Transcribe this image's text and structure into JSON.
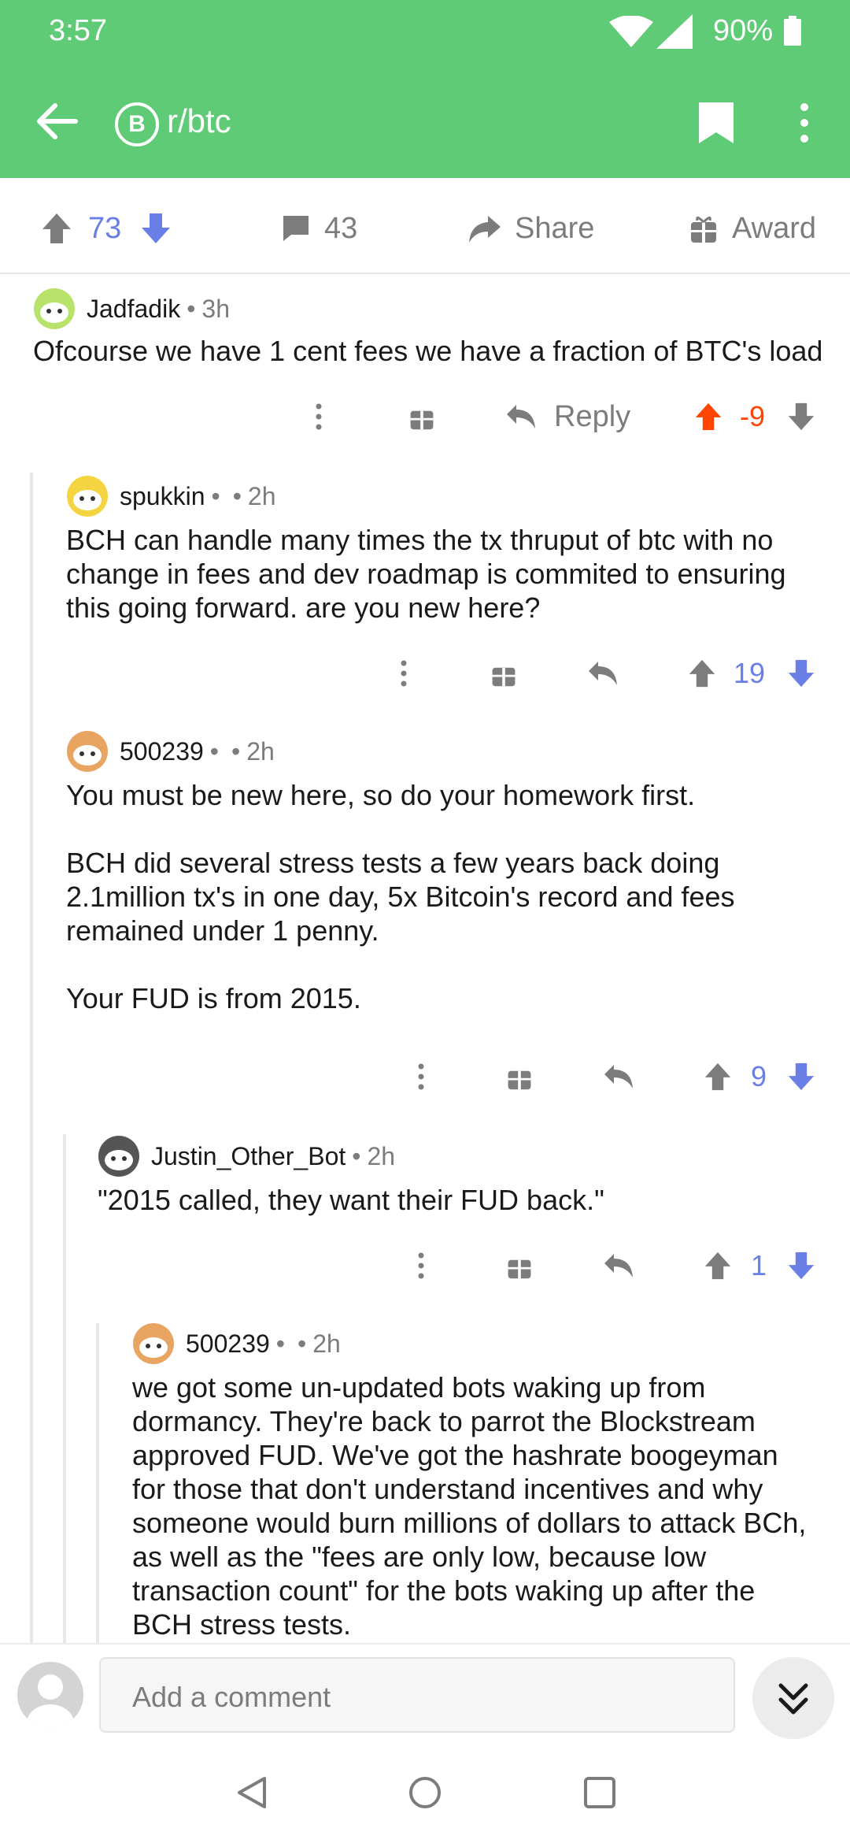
{
  "status": {
    "time": "3:57",
    "battery": "90%"
  },
  "header": {
    "subreddit": "r/btc",
    "subreddit_icon_glyph": "B"
  },
  "post_actions": {
    "score": "73",
    "comments": "43",
    "share": "Share",
    "award": "Award"
  },
  "composer": {
    "placeholder": "Add a comment"
  },
  "colors": {
    "header_green": "#5fcb76",
    "upvote_orange": "#ff4500",
    "vote_blue": "#6a7fe6"
  },
  "comments": [
    {
      "user": "Jadfadik",
      "sep1": "•",
      "age": "3h",
      "text": "Ofcourse we have 1 cent fees we have a fraction of BTC's load",
      "reply_label": "Reply",
      "score": "-9"
    },
    {
      "user": "spukkin",
      "sep1": "•",
      "sep2": "•",
      "age": "2h",
      "text": "BCH can handle many times the tx thruput of btc with no change in fees and dev roadmap is commited to ensuring this going forward. are you new here?",
      "score": "19"
    },
    {
      "user": "500239",
      "sep1": "•",
      "sep2": "•",
      "age": "2h",
      "text": "You must be new here, so do your homework first.\n\nBCH did several stress tests a few years back doing 2.1million tx's in one day, 5x Bitcoin's record and fees remained under 1 penny.\n\nYour FUD is from 2015.",
      "score": "9"
    },
    {
      "user": "Justin_Other_Bot",
      "sep1": "•",
      "age": "2h",
      "text": "\"2015 called, they want their FUD back.\"",
      "score": "1"
    },
    {
      "user": "500239",
      "sep1": "•",
      "sep2": "•",
      "age": "2h",
      "text": "we got some un-updated bots waking up from dormancy. They're back to parrot the Blockstream approved FUD. We've got the hashrate boogeyman for those that don't understand incentives and why someone would burn millions of dollars to attack BCh, as well as the \"fees are only low, because low transaction count\" for the bots waking up after the BCH stress tests."
    }
  ]
}
